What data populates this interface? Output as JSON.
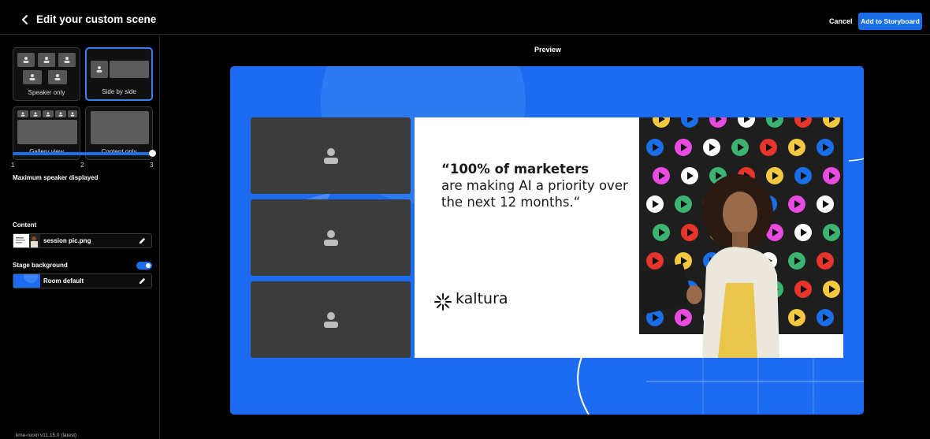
{
  "header": {
    "title": "Edit your custom scene",
    "back_icon": "chevron-left-icon",
    "cancel_label": "Cancel",
    "add_label": "Add to Storyboard"
  },
  "sidebar": {
    "layouts": [
      {
        "label": "Speaker only",
        "selected": false
      },
      {
        "label": "Side by side",
        "selected": true
      },
      {
        "label": "Gallery view",
        "selected": false
      },
      {
        "label": "Content only",
        "selected": false
      }
    ],
    "max_speaker": {
      "label": "Maximum speaker displayed",
      "ticks": [
        "1",
        "2",
        "3"
      ],
      "value": 3
    },
    "content": {
      "label": "Content",
      "file_name": "session pic.png"
    },
    "stage_background": {
      "label": "Stage background",
      "enabled": true,
      "value": "Room default"
    },
    "version": "kme-room v11.15.0 (latest)"
  },
  "preview": {
    "label": "Preview",
    "quote_bold": "“100% of marketers",
    "quote_rest": "are making AI a priority over the next 12 months.“",
    "brand": "kaltura",
    "colors": {
      "stage": "#1d6bf0",
      "tile": "#3c3c3c",
      "accent": "#1a6fe8"
    }
  }
}
